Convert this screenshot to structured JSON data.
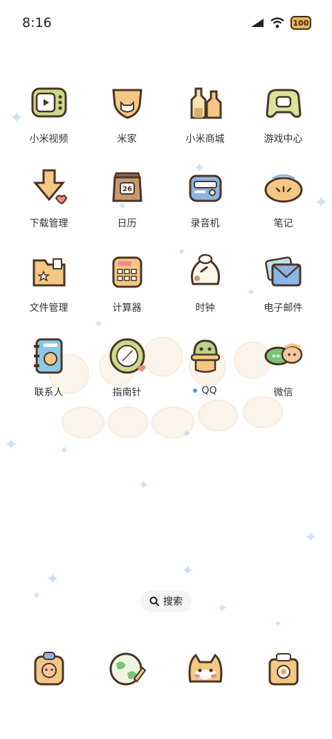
{
  "status_bar": {
    "time": "8:16",
    "battery": "100",
    "icons": [
      "signal-icon",
      "wifi-icon",
      "battery-icon"
    ]
  },
  "apps": [
    {
      "label": "小米视频",
      "icon": "tv-icon"
    },
    {
      "label": "米家",
      "icon": "cat-shield-icon"
    },
    {
      "label": "小米商城",
      "icon": "shop-bottles-icon"
    },
    {
      "label": "游戏中心",
      "icon": "game-controller-icon"
    },
    {
      "label": "下载管理",
      "icon": "download-arrow-icon"
    },
    {
      "label": "日历",
      "icon": "calendar-bag-icon",
      "date": "26"
    },
    {
      "label": "录音机",
      "icon": "radio-recorder-icon"
    },
    {
      "label": "笔记",
      "icon": "notes-bread-icon"
    },
    {
      "label": "文件管理",
      "icon": "folder-icon"
    },
    {
      "label": "计算器",
      "icon": "calculator-icon"
    },
    {
      "label": "时钟",
      "icon": "rice-dumpling-clock-icon"
    },
    {
      "label": "电子邮件",
      "icon": "envelope-icon"
    },
    {
      "label": "联系人",
      "icon": "contacts-book-icon"
    },
    {
      "label": "指南针",
      "icon": "compass-icon"
    },
    {
      "label": "QQ",
      "icon": "qq-penguin-icon",
      "notification_dot": true
    },
    {
      "label": "微信",
      "icon": "wechat-chat-icon"
    }
  ],
  "search": {
    "label": "搜索",
    "icon": "search-icon"
  },
  "dock": [
    {
      "icon": "phone-bear-icon"
    },
    {
      "icon": "browser-globe-icon"
    },
    {
      "icon": "cat-face-camera-icon"
    },
    {
      "icon": "flower-box-icon"
    }
  ],
  "colors": {
    "icon_outline": "#4a3424",
    "icon_fill_warm": "#f3c884",
    "icon_fill_green": "#c8dc88",
    "icon_fill_blue": "#8cb4e6",
    "sparkle": "#cfe0f7",
    "notification_dot": "#5a9bd8"
  }
}
